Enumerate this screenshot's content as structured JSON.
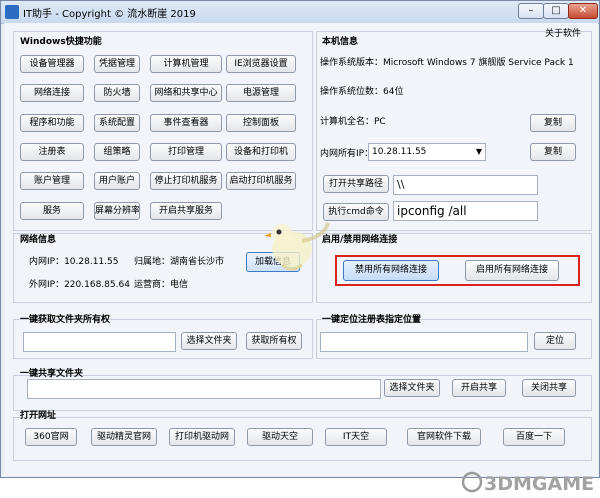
{
  "window": {
    "title": "IT助手 - Copyright © 流水断崖 2019",
    "minimize_glyph": "–",
    "maximize_glyph": "□",
    "close_glyph": "✕",
    "about": "关于软件"
  },
  "quick": {
    "title": "Windows快捷功能",
    "rows": [
      [
        "设备管理器",
        "凭据管理",
        "计算机管理",
        "IE浏览器设置"
      ],
      [
        "网络连接",
        "防火墙",
        "网络和共享中心",
        "电源管理"
      ],
      [
        "程序和功能",
        "系统配置",
        "事件查看器",
        "控制面板"
      ],
      [
        "注册表",
        "组策略",
        "打印管理",
        "设备和打印机"
      ],
      [
        "账户管理",
        "用户账户",
        "停止打印机服务",
        "启动打印机服务"
      ],
      [
        "服务",
        "屏幕分辨率",
        "开启共享服务"
      ]
    ]
  },
  "machine": {
    "title": "本机信息",
    "os_version": "操作系统版本：Microsoft Windows 7 旗舰版  Service Pack 1",
    "os_bits": "操作系统位数：64位",
    "computer_name": "计算机全名：PC",
    "lan_ip_label": "内网所有IP：",
    "lan_ip_value": "10.28.11.55",
    "copy": "复制",
    "open_share_btn": "打开共享路径",
    "share_path": "\\\\",
    "run_cmd_btn": "执行cmd命令",
    "cmd_value": "ipconfig /all"
  },
  "netinfo": {
    "title": "网络信息",
    "lan_ip": "内网IP：10.28.11.55",
    "location": "归属地：湖南省长沙市",
    "wan_ip": "外网IP：220.168.85.64",
    "isp": "运营商：电信",
    "load_btn": "加载信息"
  },
  "netconn": {
    "title": "启用/禁用网络连接",
    "disable_btn": "禁用所有网络连接",
    "enable_btn": "启用所有网络连接",
    "highlight_color": "#d9231f"
  },
  "ownership": {
    "title": "一键获取文件夹所有权",
    "choose_btn": "选择文件夹",
    "get_btn": "获取所有权"
  },
  "regloc": {
    "title": "一键定位注册表指定位置",
    "locate_btn": "定位"
  },
  "share": {
    "title": "一键共享文件夹",
    "choose_btn": "选择文件夹",
    "open_btn": "开启共享",
    "close_btn": "关闭共享"
  },
  "urls": {
    "title": "打开网址",
    "buttons": [
      "360官网",
      "驱动精灵官网",
      "打印机驱动网",
      "驱动天空",
      "IT天空",
      "官网软件下载",
      "百度一下"
    ]
  },
  "watermark": "3DMGAME"
}
